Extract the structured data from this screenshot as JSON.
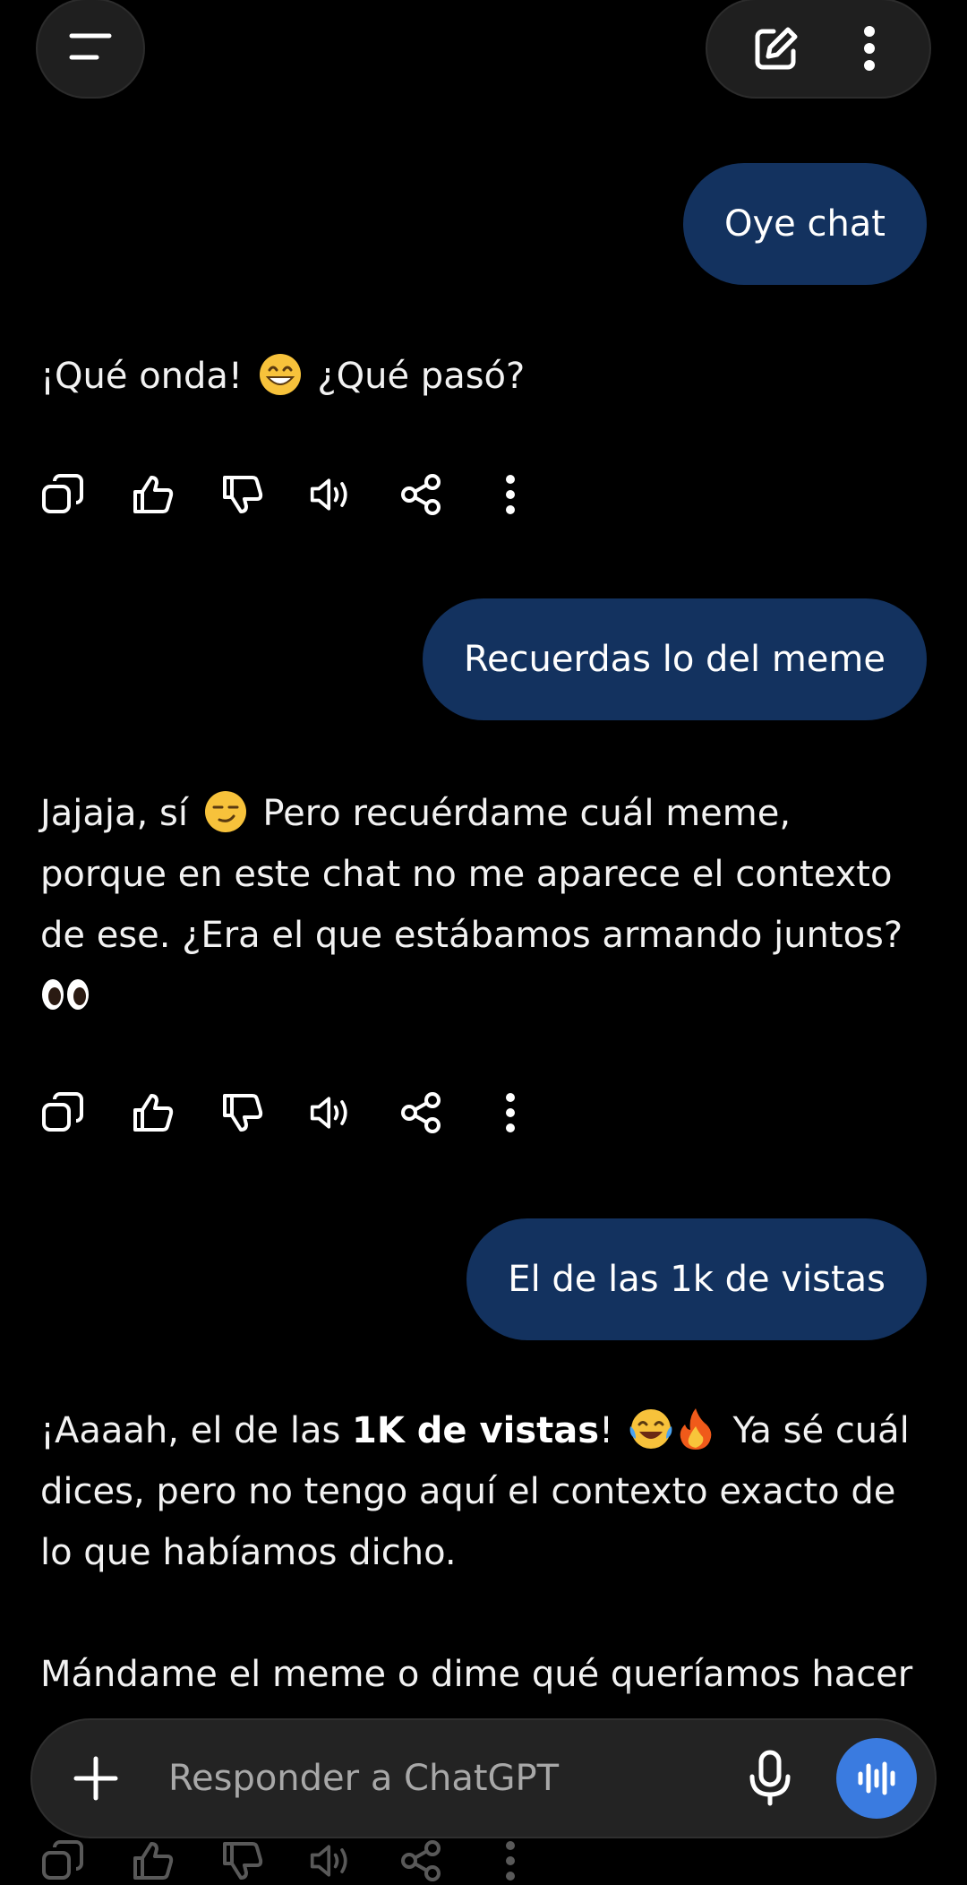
{
  "messages": {
    "user1": "Oye chat",
    "assistant1": {
      "before": "¡Qué onda!",
      "after": "¿Qué pasó?"
    },
    "user2": "Recuerdas lo del meme",
    "assistant2": {
      "part1": "Jajaja, sí",
      "part2": "Pero recuérdame cuál meme, porque en este chat no me aparece el contexto de ese. ¿Era el que estábamos armando juntos?"
    },
    "user3": "El de las 1k de vistas",
    "assistant3": {
      "p1_pre": "¡Aaaah, el de las ",
      "p1_bold": "1K de vistas",
      "p1_post": "!",
      "p1_rest": "Ya sé cuál dices, pero no tengo aquí el contexto exacto de lo que habíamos dicho.",
      "p2": "Mándame el meme o dime qué queríamos hacer"
    }
  },
  "composer": {
    "placeholder": "Responder a ChatGPT"
  },
  "icons": {
    "menu": "menu-icon",
    "new_chat": "edit-icon",
    "more": "more-vertical-icon",
    "copy": "copy-icon",
    "like": "thumbs-up-icon",
    "dislike": "thumbs-down-icon",
    "speaker": "speaker-icon",
    "share": "share-icon",
    "plus": "plus-icon",
    "mic": "mic-icon",
    "voice": "voice-mode-icon"
  },
  "colors": {
    "user_bubble": "#13325f",
    "voice_button": "#3a7be0",
    "composer_bg": "#232323"
  }
}
